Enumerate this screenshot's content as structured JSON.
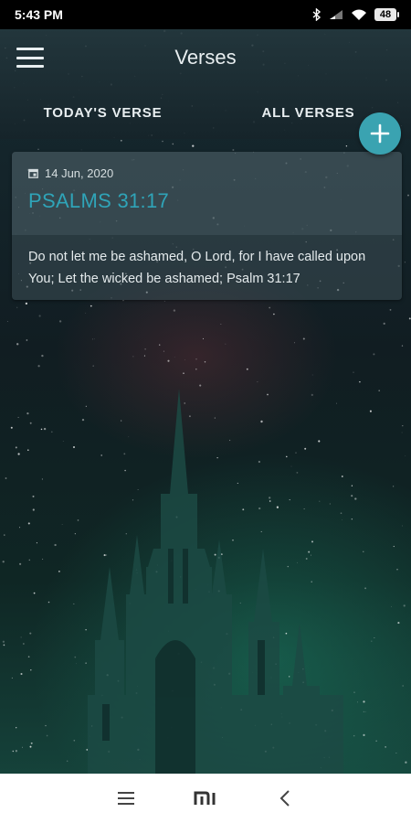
{
  "status_bar": {
    "time": "5:43 PM",
    "battery": "48",
    "icons": [
      "bluetooth-icon",
      "signal-icon",
      "wifi-icon",
      "battery-icon"
    ]
  },
  "app_bar": {
    "title": "Verses",
    "menu_icon": "hamburger-menu-icon"
  },
  "tabs": [
    {
      "label": "TODAY'S VERSE"
    },
    {
      "label": "ALL VERSES"
    }
  ],
  "fab": {
    "icon": "plus-icon"
  },
  "verse_card": {
    "date": "14 Jun, 2020",
    "date_icon": "calendar-icon",
    "reference": "PSALMS 31:17",
    "text": "Do not let me be ashamed, O Lord, for I have called upon You; Let the wicked be ashamed; Psalm 31:17"
  },
  "nav_bar": {
    "icons": [
      "recents-menu-icon",
      "home-mi-icon",
      "back-icon"
    ]
  },
  "colors": {
    "accent": "#3aa3b1",
    "reference_text": "#2fa4b8",
    "status_bar": "#000000",
    "nav_bar": "#ffffff"
  }
}
